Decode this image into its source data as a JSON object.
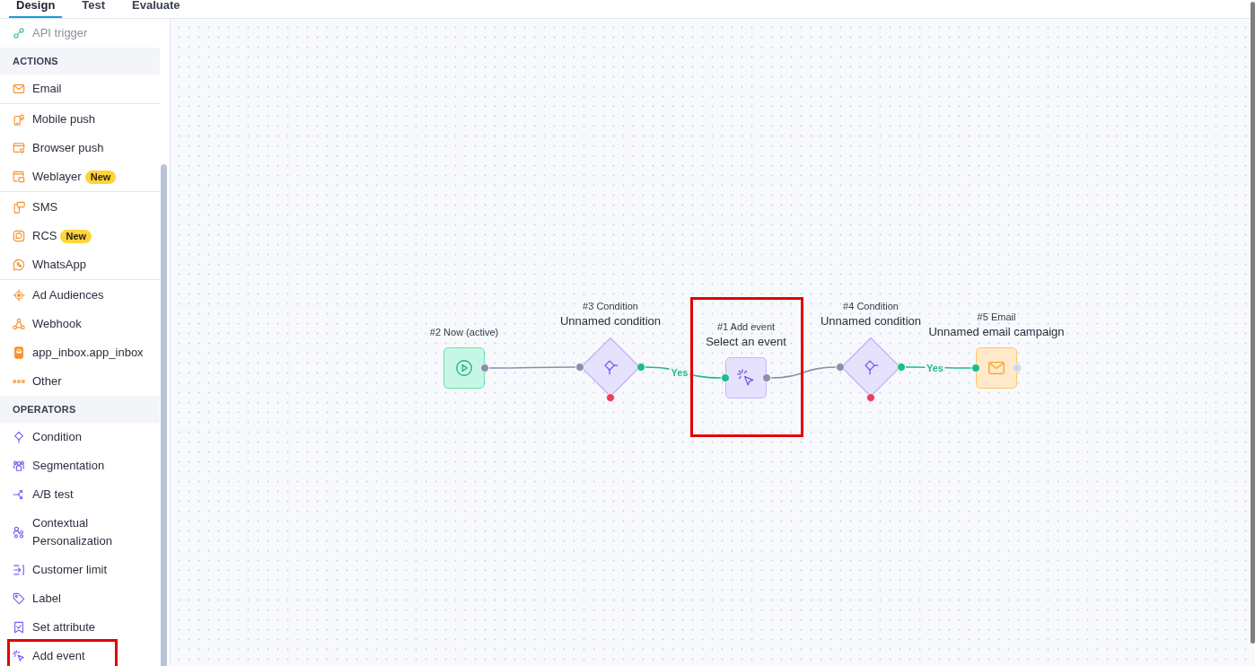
{
  "tabs": [
    {
      "label": "Design",
      "selected": true
    },
    {
      "label": "Test",
      "selected": false
    },
    {
      "label": "Evaluate",
      "selected": false
    }
  ],
  "sidebar": {
    "sections": [
      {
        "groups": [
          {
            "items": [
              {
                "label": "API trigger",
                "disabled": true,
                "highlighted": false
              }
            ]
          }
        ]
      },
      {
        "title": "ACTIONS",
        "groups": [
          {
            "items": [
              {
                "label": "Email",
                "disabled": false,
                "highlighted": false
              }
            ]
          },
          {
            "items": [
              {
                "label": "Mobile push",
                "disabled": false,
                "highlighted": false
              },
              {
                "label": "Browser push",
                "disabled": false,
                "highlighted": false
              },
              {
                "label": "Weblayer",
                "badge": "New",
                "disabled": false,
                "highlighted": false
              }
            ]
          },
          {
            "items": [
              {
                "label": "SMS",
                "disabled": false,
                "highlighted": false
              },
              {
                "label": "RCS",
                "badge": "New",
                "disabled": false,
                "highlighted": false
              },
              {
                "label": "WhatsApp",
                "disabled": false,
                "highlighted": false
              }
            ]
          },
          {
            "items": [
              {
                "label": "Ad Audiences",
                "disabled": false,
                "highlighted": false
              },
              {
                "label": "Webhook",
                "disabled": false,
                "highlighted": false
              },
              {
                "label": "app_inbox.app_inbox",
                "disabled": false,
                "highlighted": false
              },
              {
                "label": "Other",
                "disabled": false,
                "highlighted": false
              }
            ]
          }
        ]
      },
      {
        "title": "OPERATORS",
        "groups": [
          {
            "items": [
              {
                "label": "Condition",
                "disabled": false,
                "highlighted": false
              },
              {
                "label": "Segmentation",
                "disabled": false,
                "highlighted": false
              },
              {
                "label": "A/B test",
                "disabled": false,
                "highlighted": false
              },
              {
                "label": "Contextual Personalization",
                "disabled": false,
                "highlighted": false
              },
              {
                "label": "Customer limit",
                "disabled": false,
                "highlighted": false
              },
              {
                "label": "Label",
                "disabled": false,
                "highlighted": false
              },
              {
                "label": "Set attribute",
                "disabled": false,
                "highlighted": false
              },
              {
                "label": "Add event",
                "disabled": false,
                "highlighted": true
              }
            ]
          }
        ]
      }
    ]
  },
  "nodes": [
    {
      "kind": "trigger",
      "caption": "#2 Now (active)",
      "highlighted": false
    },
    {
      "kind": "condition",
      "caption": "#3 Condition",
      "title": "Unnamed condition",
      "link": {
        "kind": "plain"
      },
      "highlighted": false
    },
    {
      "kind": "event",
      "caption": "#1 Add event",
      "title": "Select an event",
      "link": {
        "kind": "yes",
        "label": "Yes"
      },
      "highlighted": true
    },
    {
      "kind": "condition",
      "caption": "#4 Condition",
      "title": "Unnamed condition",
      "link": {
        "kind": "plain"
      },
      "highlighted": false
    },
    {
      "kind": "email",
      "caption": "#5 Email",
      "title": "Unnamed email campaign",
      "link": {
        "kind": "yes",
        "label": "Yes"
      },
      "highlighted": false
    }
  ]
}
